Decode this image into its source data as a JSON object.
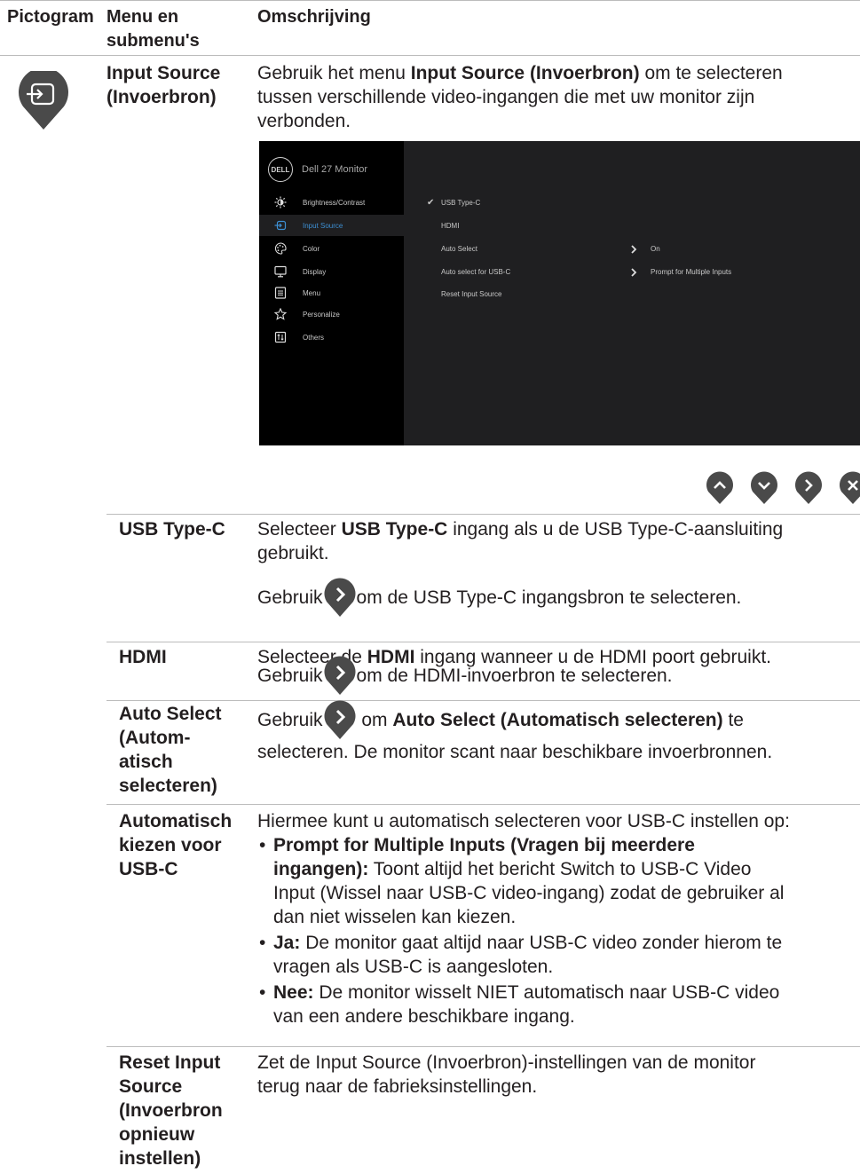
{
  "header": {
    "col_icon": "Pictogram",
    "col_menu_line1": "Menu en",
    "col_menu_line2": "submenu's",
    "col_desc": "Omschrijving"
  },
  "input_source": {
    "term_line1": "Input Source",
    "term_line2": "(Invoerbron)",
    "desc_pre": "Gebruik het menu ",
    "desc_bold": "Input Source (Invoerbron)",
    "desc_post": " om te selecteren",
    "desc_line2": "tussen verschillende video-ingangen die met uw monitor zijn",
    "desc_line3": "verbonden."
  },
  "osd": {
    "brand_logo": "DELL",
    "title": "Dell 27 Monitor",
    "menu": [
      {
        "label": "Brightness/Contrast",
        "icon": "brightness-icon"
      },
      {
        "label": "Input Source",
        "icon": "input-source-icon"
      },
      {
        "label": "Color",
        "icon": "color-palette-icon"
      },
      {
        "label": "Display",
        "icon": "display-icon"
      },
      {
        "label": "Menu",
        "icon": "menu-icon"
      },
      {
        "label": "Personalize",
        "icon": "star-icon"
      },
      {
        "label": "Others",
        "icon": "others-icon"
      }
    ],
    "selected_menu": "Input Source",
    "options": [
      {
        "label": "USB Type-C",
        "checked": true,
        "value": ""
      },
      {
        "label": "HDMI",
        "checked": false,
        "value": ""
      },
      {
        "label": "Auto Select",
        "checked": false,
        "value": "On"
      },
      {
        "label": "Auto select for USB-C",
        "checked": false,
        "value": "Prompt for Multiple Inputs"
      },
      {
        "label": "Reset Input Source",
        "checked": false,
        "value": ""
      }
    ],
    "colors": {
      "accent": "#3d8fd3",
      "panel": "#1f1f21",
      "sidebar": "#000000"
    }
  },
  "nav_buttons": [
    "up-icon",
    "down-icon",
    "right-icon",
    "close-icon"
  ],
  "usb_typec": {
    "term": "USB Type-C",
    "desc1_pre": "Selecteer ",
    "desc1_bold": "USB Type-C",
    "desc1_post": " ingang als u de USB Type-C-aansluiting",
    "desc1_line2": "gebruikt.",
    "desc2_pre": "Gebruik ",
    "desc2_post": " om de USB Type-C ingangsbron te selecteren."
  },
  "hdmi": {
    "term": "HDMI",
    "desc1_pre": "Selecteer de ",
    "desc1_bold": "HDMI",
    "desc1_post": " ingang wanneer u de HDMI poort gebruikt.",
    "desc2_pre": "Gebruik ",
    "desc2_post": " om de HDMI-invoerbron te selecteren."
  },
  "auto_select": {
    "term_line1": "Auto Select",
    "term_line2": "(Autom-",
    "term_line3": "atisch",
    "term_line4": "selecteren)",
    "desc_pre": "Gebruik ",
    "desc_mid": " om ",
    "desc_bold": "Auto Select (Automatisch selecteren)",
    "desc_post": " te",
    "desc_line2": "selecteren. De monitor scant naar beschikbare invoerbronnen."
  },
  "auto_usbc": {
    "term_line1": "Automatisch",
    "term_line2": "kiezen voor",
    "term_line3": "USB-C",
    "intro": "Hiermee kunt u automatisch selecteren voor USB-C instellen op:",
    "bullet1_bold_a": "Prompt for Multiple Inputs (Vragen bij meerdere",
    "bullet1_bold_b": "ingangen):",
    "bullet1_text_a": " Toont altijd het bericht Switch to USB-C Video",
    "bullet1_text_b": "Input (Wissel naar USB-C video-ingang) zodat de gebruiker al",
    "bullet1_text_c": "dan niet wisselen kan kiezen.",
    "bullet2_bold": "Ja:",
    "bullet2_text_a": " De monitor gaat altijd naar USB-C video zonder hierom te",
    "bullet2_text_b": "vragen als USB-C is aangesloten.",
    "bullet3_bold": "Nee:",
    "bullet3_text_a": " De monitor wisselt NIET automatisch naar USB-C video",
    "bullet3_text_b": "van een andere beschikbare ingang."
  },
  "reset": {
    "term_line1": "Reset Input",
    "term_line2": "Source",
    "term_line3": "(Invoerbron",
    "term_line4": "opnieuw",
    "term_line5": "instellen)",
    "desc_line1": "Zet de Input Source (Invoerbron)-instellingen van de monitor",
    "desc_line2": "terug naar de fabrieksinstellingen."
  }
}
